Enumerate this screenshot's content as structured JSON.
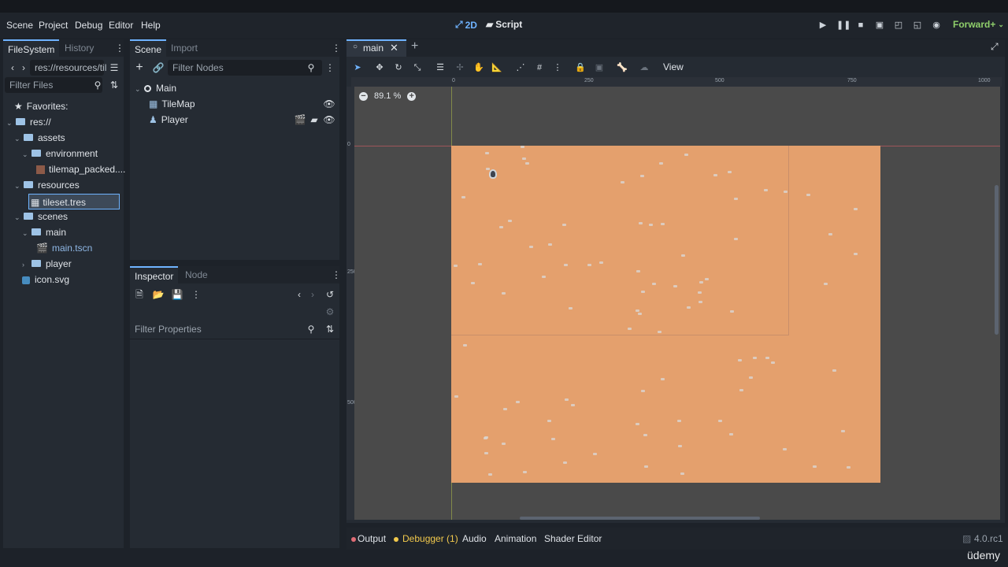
{
  "menu": {
    "items": [
      "Scene",
      "Project",
      "Debug",
      "Editor",
      "Help"
    ]
  },
  "workspaces": {
    "two_d": "2D",
    "script": "Script"
  },
  "renderer": "Forward+",
  "filesystem": {
    "tabs": [
      "FileSystem",
      "History"
    ],
    "path": "res://resources/til",
    "filter_placeholder": "Filter Files",
    "favorites_label": "Favorites:",
    "tree": [
      {
        "label": "res://"
      },
      {
        "label": "assets"
      },
      {
        "label": "environment"
      },
      {
        "label": "tilemap_packed...."
      },
      {
        "label": "resources"
      },
      {
        "label": "tileset.tres"
      },
      {
        "label": "scenes"
      },
      {
        "label": "main"
      },
      {
        "label": "main.tscn"
      },
      {
        "label": "player"
      },
      {
        "label": "icon.svg"
      }
    ]
  },
  "scene_panel": {
    "tabs": [
      "Scene",
      "Import"
    ],
    "filter_placeholder": "Filter Nodes",
    "nodes": [
      "Main",
      "TileMap",
      "Player"
    ]
  },
  "inspector": {
    "tabs": [
      "Inspector",
      "Node"
    ],
    "filter_placeholder": "Filter Properties"
  },
  "editor_tab": {
    "label": "main"
  },
  "viewport": {
    "view_menu": "View",
    "zoom": "89.1 %",
    "ruler_labels": [
      "0",
      "250",
      "500",
      "750",
      "1000"
    ],
    "vruler_labels": [
      "0",
      "250",
      "500"
    ]
  },
  "bottom_panel": {
    "tabs": [
      "Output",
      "Debugger (1)",
      "Animation",
      "Shader Editor"
    ],
    "audio": "Audio",
    "version": "4.0.rc1"
  },
  "watermark": "üdemy",
  "colors": {
    "accent": "#6fb3ff",
    "tilemap": "#e4a06d",
    "canvas": "#4a4a4a",
    "debug_dot": "#f2c94c",
    "error_dot": "#e06c75"
  }
}
